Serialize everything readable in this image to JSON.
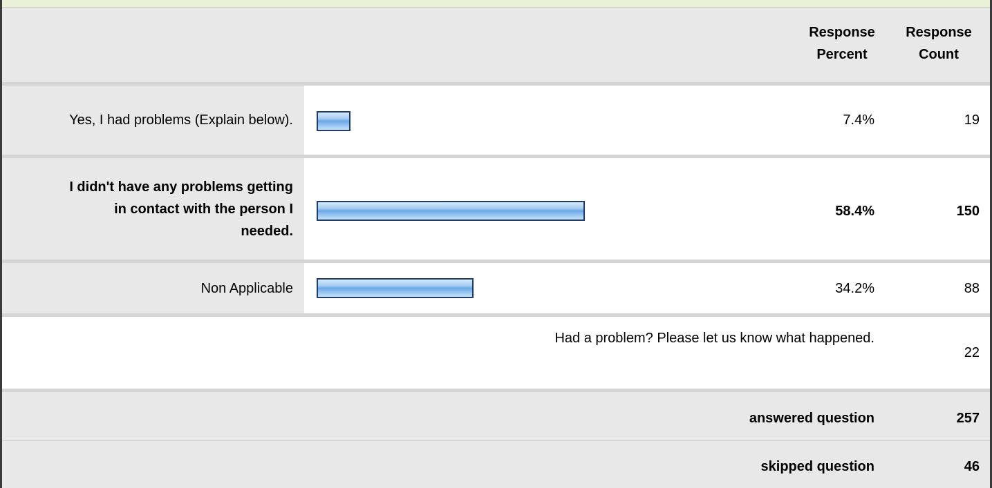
{
  "header": {
    "response_percent": "Response Percent",
    "response_count": "Response Count"
  },
  "choices": [
    {
      "label": "Yes, I had problems (Explain below).",
      "percent_text": "7.4%",
      "percent_value": 7.4,
      "count": "19",
      "bold": false
    },
    {
      "label": "I didn't have any problems getting in contact with the person I needed.",
      "percent_text": "58.4%",
      "percent_value": 58.4,
      "count": "150",
      "bold": true
    },
    {
      "label": "Non Applicable",
      "percent_text": "34.2%",
      "percent_value": 34.2,
      "count": "88",
      "bold": false
    }
  ],
  "open_text": {
    "prompt": "Had a problem? Please let us know what happened.",
    "count": "22"
  },
  "summary": {
    "answered_label": "answered question",
    "answered_value": "257",
    "skipped_label": "skipped question",
    "skipped_value": "46"
  },
  "colors": {
    "bar_fill": "#8fc0ef",
    "bar_border": "#1e3d6b",
    "row_gray": "#e8e8e8"
  }
}
